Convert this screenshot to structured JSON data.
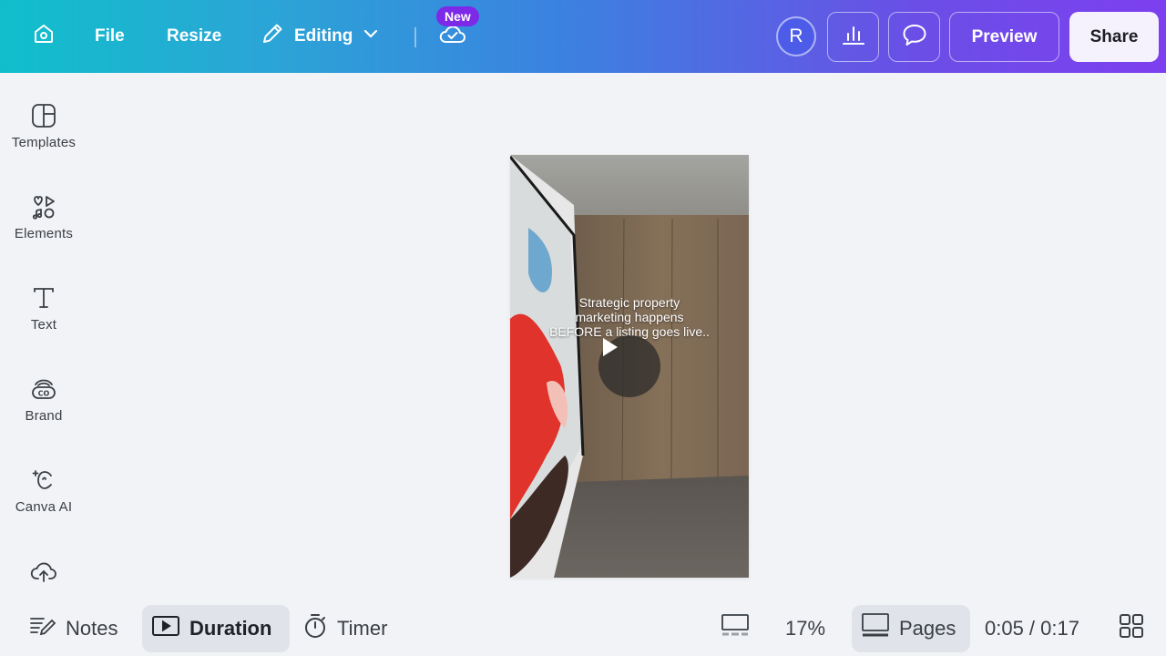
{
  "header": {
    "file_label": "File",
    "resize_label": "Resize",
    "editing_label": "Editing",
    "new_badge": "New",
    "avatar_initial": "R",
    "preview_label": "Preview",
    "share_label": "Share",
    "icons": [
      "home-icon",
      "pencil-icon",
      "chevron-down-icon",
      "cloud-check-icon",
      "bar-chart-icon",
      "comment-icon"
    ]
  },
  "sidebar": {
    "items": [
      {
        "label": "Templates",
        "icon": "templates-icon"
      },
      {
        "label": "Elements",
        "icon": "elements-icon"
      },
      {
        "label": "Text",
        "icon": "text-icon"
      },
      {
        "label": "Brand",
        "icon": "brand-icon"
      },
      {
        "label": "Canva AI",
        "icon": "canva-ai-icon"
      },
      {
        "label": "",
        "icon": "upload-icon"
      }
    ]
  },
  "canvas": {
    "overlay_lines": [
      "Strategic property",
      "marketing happens",
      "BEFORE a listing goes live.."
    ]
  },
  "bottombar": {
    "notes_label": "Notes",
    "duration_label": "Duration",
    "timer_label": "Timer",
    "zoom": "17%",
    "pages_label": "Pages",
    "time": "0:05 / 0:17"
  },
  "colors": {
    "gradient_start": "#10bfcb",
    "gradient_end": "#7d3ff0",
    "badge": "#7d2ae8",
    "avatar": "#4d5ce8"
  }
}
